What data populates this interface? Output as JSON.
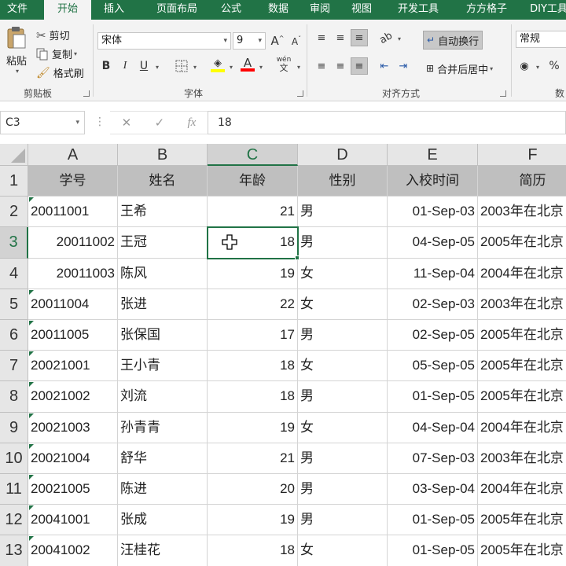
{
  "ribbon_tabs": [
    "文件",
    "开始",
    "插入",
    "页面布局",
    "公式",
    "数据",
    "审阅",
    "视图",
    "开发工具",
    "方方格子",
    "DIY工具"
  ],
  "active_tab": "开始",
  "clipboard": {
    "paste": "粘贴",
    "cut": "剪切",
    "copy": "复制",
    "format_painter": "格式刷",
    "group_label": "剪贴板"
  },
  "font": {
    "name": "宋体",
    "size": "9",
    "bold": "B",
    "italic": "I",
    "underline": "U",
    "font_color_letter": "A",
    "phonetic_label": "wén",
    "group_label": "字体",
    "highlight_color": "#ffff00",
    "font_color": "#ff0000"
  },
  "alignment": {
    "wrap_text": "自动换行",
    "merge_center": "合并后居中",
    "group_label": "对齐方式"
  },
  "number": {
    "format": "常规",
    "percent": "%",
    "group_label": "数"
  },
  "formula_bar": {
    "name_box": "C3",
    "cancel": "✕",
    "enter": "✓",
    "fx": "fx",
    "value": "18"
  },
  "columns": [
    "A",
    "B",
    "C",
    "D",
    "E",
    "F"
  ],
  "selected_cell": "C3",
  "headers": [
    "学号",
    "姓名",
    "年龄",
    "性别",
    "入校时间",
    "简历"
  ],
  "rows": [
    {
      "n": "2",
      "id": "20011001",
      "name": "王希",
      "age": "21",
      "sex": "男",
      "date": "01-Sep-03",
      "resume": "2003年在北京"
    },
    {
      "n": "3",
      "id": "20011002",
      "name": "王冠",
      "age": "18",
      "sex": "男",
      "date": "04-Sep-05",
      "resume": "2005年在北京"
    },
    {
      "n": "4",
      "id": "20011003",
      "name": "陈风",
      "age": "19",
      "sex": "女",
      "date": "11-Sep-04",
      "resume": "2004年在北京"
    },
    {
      "n": "5",
      "id": "20011004",
      "name": "张进",
      "age": "22",
      "sex": "女",
      "date": "02-Sep-03",
      "resume": "2003年在北京"
    },
    {
      "n": "6",
      "id": "20011005",
      "name": "张保国",
      "age": "17",
      "sex": "男",
      "date": "02-Sep-05",
      "resume": "2005年在北京"
    },
    {
      "n": "7",
      "id": "20021001",
      "name": "王小青",
      "age": "18",
      "sex": "女",
      "date": "05-Sep-05",
      "resume": "2005年在北京"
    },
    {
      "n": "8",
      "id": "20021002",
      "name": "刘流",
      "age": "18",
      "sex": "男",
      "date": "01-Sep-05",
      "resume": "2005年在北京"
    },
    {
      "n": "9",
      "id": "20021003",
      "name": "孙青青",
      "age": "19",
      "sex": "女",
      "date": "04-Sep-04",
      "resume": "2004年在北京"
    },
    {
      "n": "10",
      "id": "20021004",
      "name": "舒华",
      "age": "21",
      "sex": "男",
      "date": "07-Sep-03",
      "resume": "2003年在北京"
    },
    {
      "n": "11",
      "id": "20021005",
      "name": "陈进",
      "age": "20",
      "sex": "男",
      "date": "03-Sep-04",
      "resume": "2004年在北京"
    },
    {
      "n": "12",
      "id": "20041001",
      "name": "张成",
      "age": "19",
      "sex": "男",
      "date": "01-Sep-05",
      "resume": "2005年在北京"
    },
    {
      "n": "13",
      "id": "20041002",
      "name": "汪桂花",
      "age": "18",
      "sex": "女",
      "date": "01-Sep-05",
      "resume": "2005年在北京"
    }
  ],
  "header_row_number": "1",
  "right_aligned_id_rows": [
    "3",
    "4"
  ],
  "accent_color": "#217346"
}
